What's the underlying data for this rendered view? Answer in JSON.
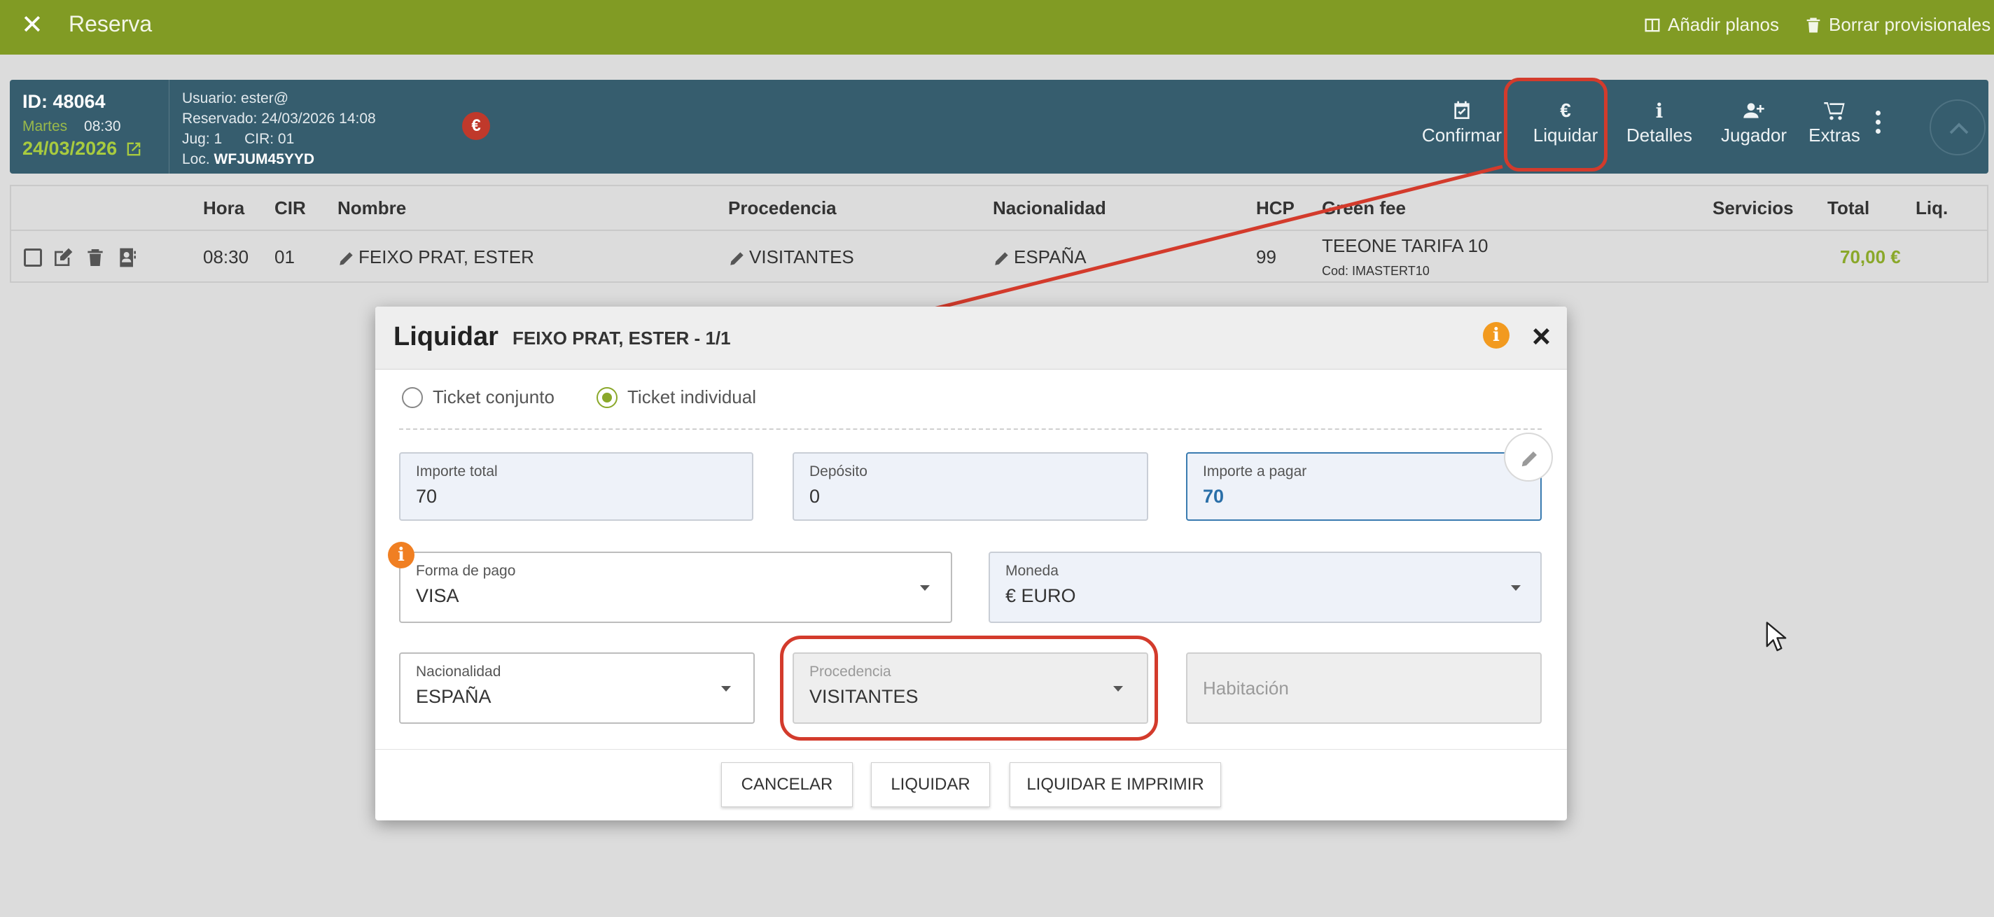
{
  "topbar": {
    "title": "Reserva",
    "add_plans": "Añadir planos",
    "delete_provisional": "Borrar provisionales"
  },
  "booking": {
    "id": "ID: 48064",
    "weekday": "Martes",
    "time": "08:30",
    "date": "24/03/2026",
    "user": "Usuario: ester@",
    "reserved": "Reservado: 24/03/2026 14:08",
    "players": "Jug: 1",
    "cir": "CIR: 01",
    "loc_label": "Loc.",
    "loc_code": "WFJUM45YYD",
    "currency_badge": "€",
    "actions": {
      "confirm": "Confirmar",
      "settle": "Liquidar",
      "settle_icon": "€",
      "details": "Detalles",
      "details_icon": "i",
      "player": "Jugador",
      "extras": "Extras"
    }
  },
  "table": {
    "headers": {
      "hora": "Hora",
      "cir": "CIR",
      "nombre": "Nombre",
      "procedencia": "Procedencia",
      "nacionalidad": "Nacionalidad",
      "hcp": "HCP",
      "green_fee": "Green fee",
      "servicios": "Servicios",
      "total": "Total",
      "liq": "Liq."
    },
    "row": {
      "hora": "08:30",
      "cir": "01",
      "nombre": "FEIXO PRAT, ESTER",
      "procedencia": "VISITANTES",
      "nacionalidad": "ESPAÑA",
      "hcp": "99",
      "green_fee": "TEEONE TARIFA 10",
      "green_fee_code": "Cod: IMASTERT10",
      "total": "70,00 €"
    }
  },
  "modal": {
    "title": "Liquidar",
    "subtitle": "FEIXO PRAT, ESTER - 1/1",
    "info_icon": "i",
    "close": "×",
    "radio_joint": "Ticket conjunto",
    "radio_individual": "Ticket individual",
    "selected_ticket": "individual",
    "importe_total": {
      "label": "Importe total",
      "value": "70"
    },
    "deposito": {
      "label": "Depósito",
      "value": "0"
    },
    "importe_pagar": {
      "label": "Importe a pagar",
      "value": "70"
    },
    "warn_icon": "i",
    "forma_pago": {
      "label": "Forma de pago",
      "value": "VISA"
    },
    "moneda": {
      "label": "Moneda",
      "value": "€ EURO"
    },
    "nacionalidad": {
      "label": "Nacionalidad",
      "value": "ESPAÑA"
    },
    "procedencia": {
      "label": "Procedencia",
      "value": "VISITANTES"
    },
    "habitacion": {
      "placeholder": "Habitación"
    },
    "buttons": {
      "cancel": "CANCELAR",
      "settle": "LIQUIDAR",
      "settle_print": "LIQUIDAR E IMPRIMIR"
    }
  },
  "colors": {
    "topbar": "#819b24",
    "booking_bar": "#365d6e",
    "accent_green": "#8aa82a",
    "annotation_red": "#d33b2c",
    "info_orange": "#f29a1f"
  }
}
